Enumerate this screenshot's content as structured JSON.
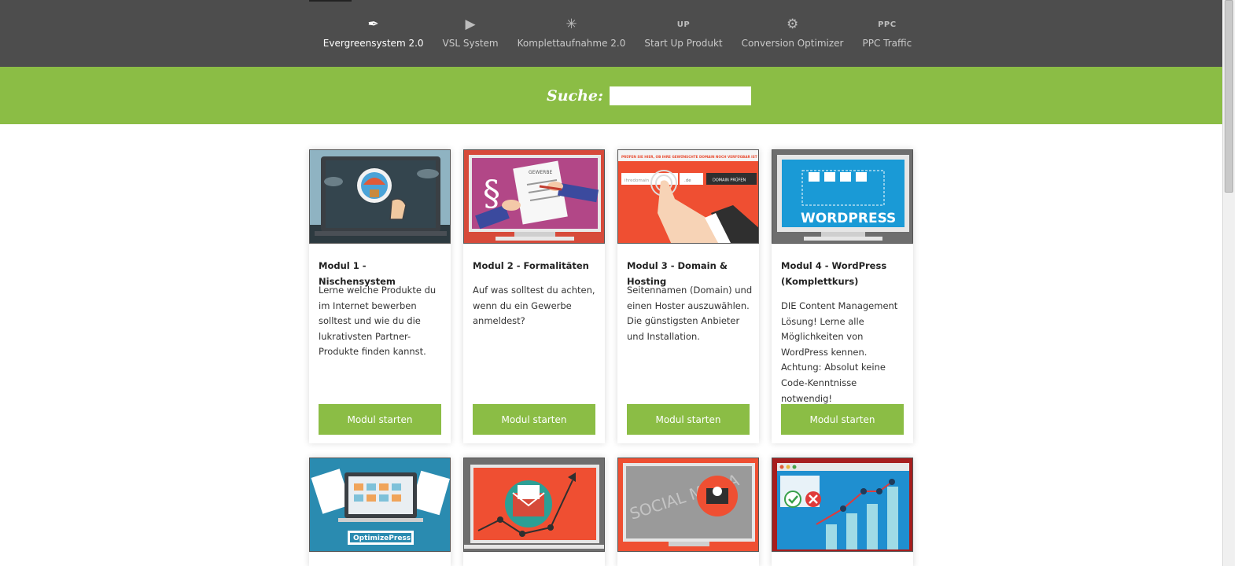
{
  "nav": {
    "items": [
      {
        "label": "Evergreensystem 2.0",
        "icon": "feather-icon",
        "glyph": "✒",
        "active": true
      },
      {
        "label": "VSL System",
        "icon": "film-icon",
        "glyph": "▶",
        "active": false
      },
      {
        "label": "Komplettaufnahme 2.0",
        "icon": "network-icon",
        "glyph": "✳",
        "active": false
      },
      {
        "label": "Start Up Produkt",
        "icon": "up-icon",
        "glyph": "UP",
        "active": false
      },
      {
        "label": "Conversion Optimizer",
        "icon": "gear-icon",
        "glyph": "⚙",
        "active": false
      },
      {
        "label": "PPC Traffic",
        "icon": "ppc-icon",
        "glyph": "PPC",
        "active": false
      }
    ]
  },
  "search": {
    "label": "Suche:",
    "value": "",
    "placeholder": ""
  },
  "modules": [
    {
      "title": "Modul 1 - Nischensystem",
      "desc": "Lerne welche Produkte du im Internet bewerben solltest und wie du die lukrativsten Partner-Produkte finden kannst.",
      "button": "Modul starten"
    },
    {
      "title": "Modul 2 - Formalitäten",
      "desc": "Auf was solltest du achten, wenn du ein Gewerbe anmeldest?",
      "button": "Modul starten",
      "img_text": "GEWERBE"
    },
    {
      "title": "Modul 3 - Domain & Hosting",
      "desc": "Seitennamen (Domain) und einen Hoster auszuwählen. Die günstigsten Anbieter und Installation.",
      "button": "Modul starten",
      "img_banner": "PRÜFEN SIE HIER, OB IHRE GEWÜNSCHTE DOMAIN NOCH VERFÜGBAR IST",
      "img_field": "ihredomain",
      "img_select": ".de",
      "img_button": "DOMAIN PRÜFEN"
    },
    {
      "title": "Modul 4 - WordPress (Komplettkurs)",
      "desc": "DIE Content Management Lösung! Lerne alle Möglichkeiten von WordPress kennen. Achtung: Absolut keine Code-Kenntnisse notwendig!",
      "button": "Modul starten",
      "img_text": "WORDPRESS"
    }
  ],
  "row2": [
    {
      "img_text": "OptimizePress"
    },
    {},
    {
      "img_text": "SOCIAL MEDIA"
    },
    {}
  ],
  "colors": {
    "nav_bg": "#4d4d4d",
    "accent_green": "#8bbd45"
  }
}
